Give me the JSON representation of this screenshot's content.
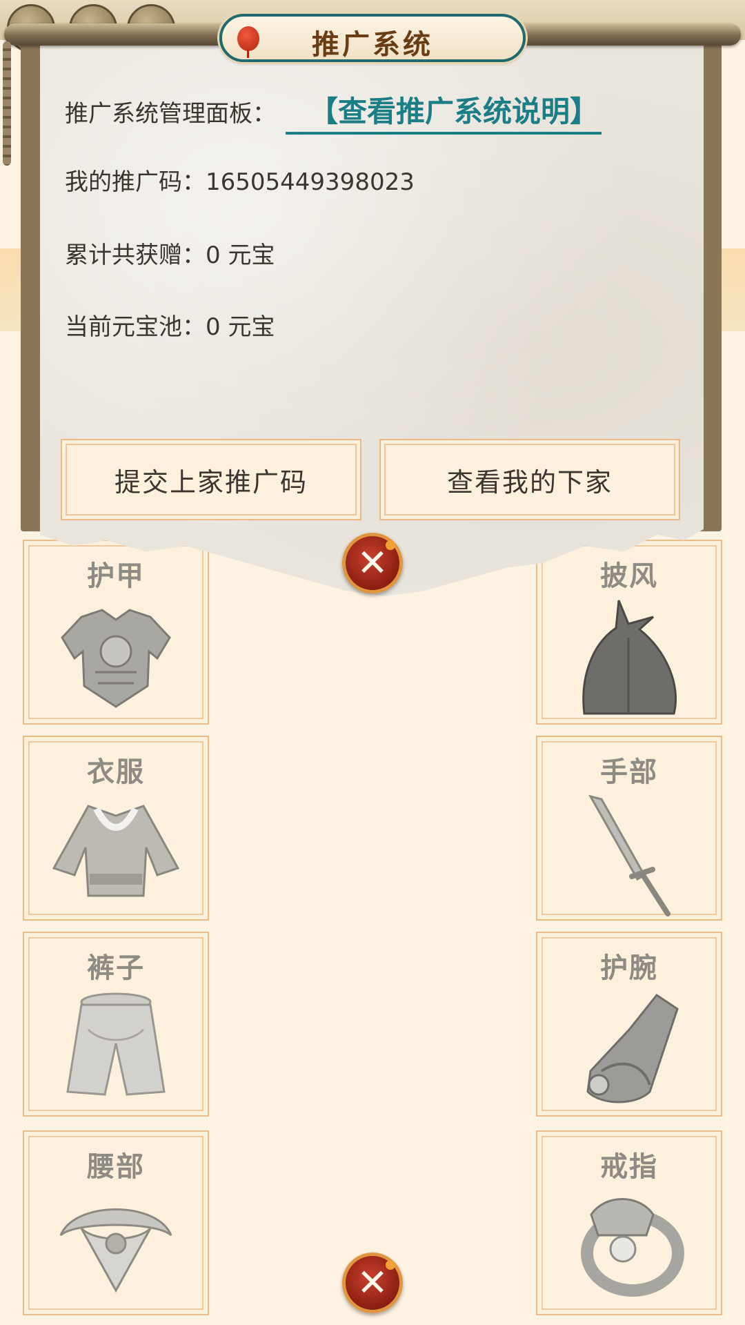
{
  "dialog": {
    "title": "推广系统",
    "panel_label": "推广系统管理面板：",
    "help_link": "【查看推广系统说明】",
    "code_label": "我的推广码：",
    "code_value": "16505449398023",
    "total_label": "累计共获赠：",
    "total_value": "0 元宝",
    "pool_label": "当前元宝池：",
    "pool_value": "0 元宝",
    "submit_button": "提交上家推广码",
    "view_button": "查看我的下家",
    "close_symbol": "✕"
  },
  "equipment": {
    "left": [
      "护甲",
      "衣服",
      "裤子",
      "腰部"
    ],
    "right": [
      "披风",
      "手部",
      "护腕",
      "戒指"
    ],
    "close_symbol": "✕"
  },
  "icons": {
    "armor": "armor-icon",
    "cloak": "cloak-icon",
    "clothes": "clothes-icon",
    "weapon": "sword-icon",
    "pants": "pants-icon",
    "bracer": "bracer-icon",
    "belt": "belt-icon",
    "ring": "ring-icon",
    "close": "close-icon"
  },
  "colors": {
    "accent_teal": "#1b7d86",
    "close_red": "#b3301d",
    "slot_border": "#e9bb86",
    "background": "#fdf3e3"
  }
}
